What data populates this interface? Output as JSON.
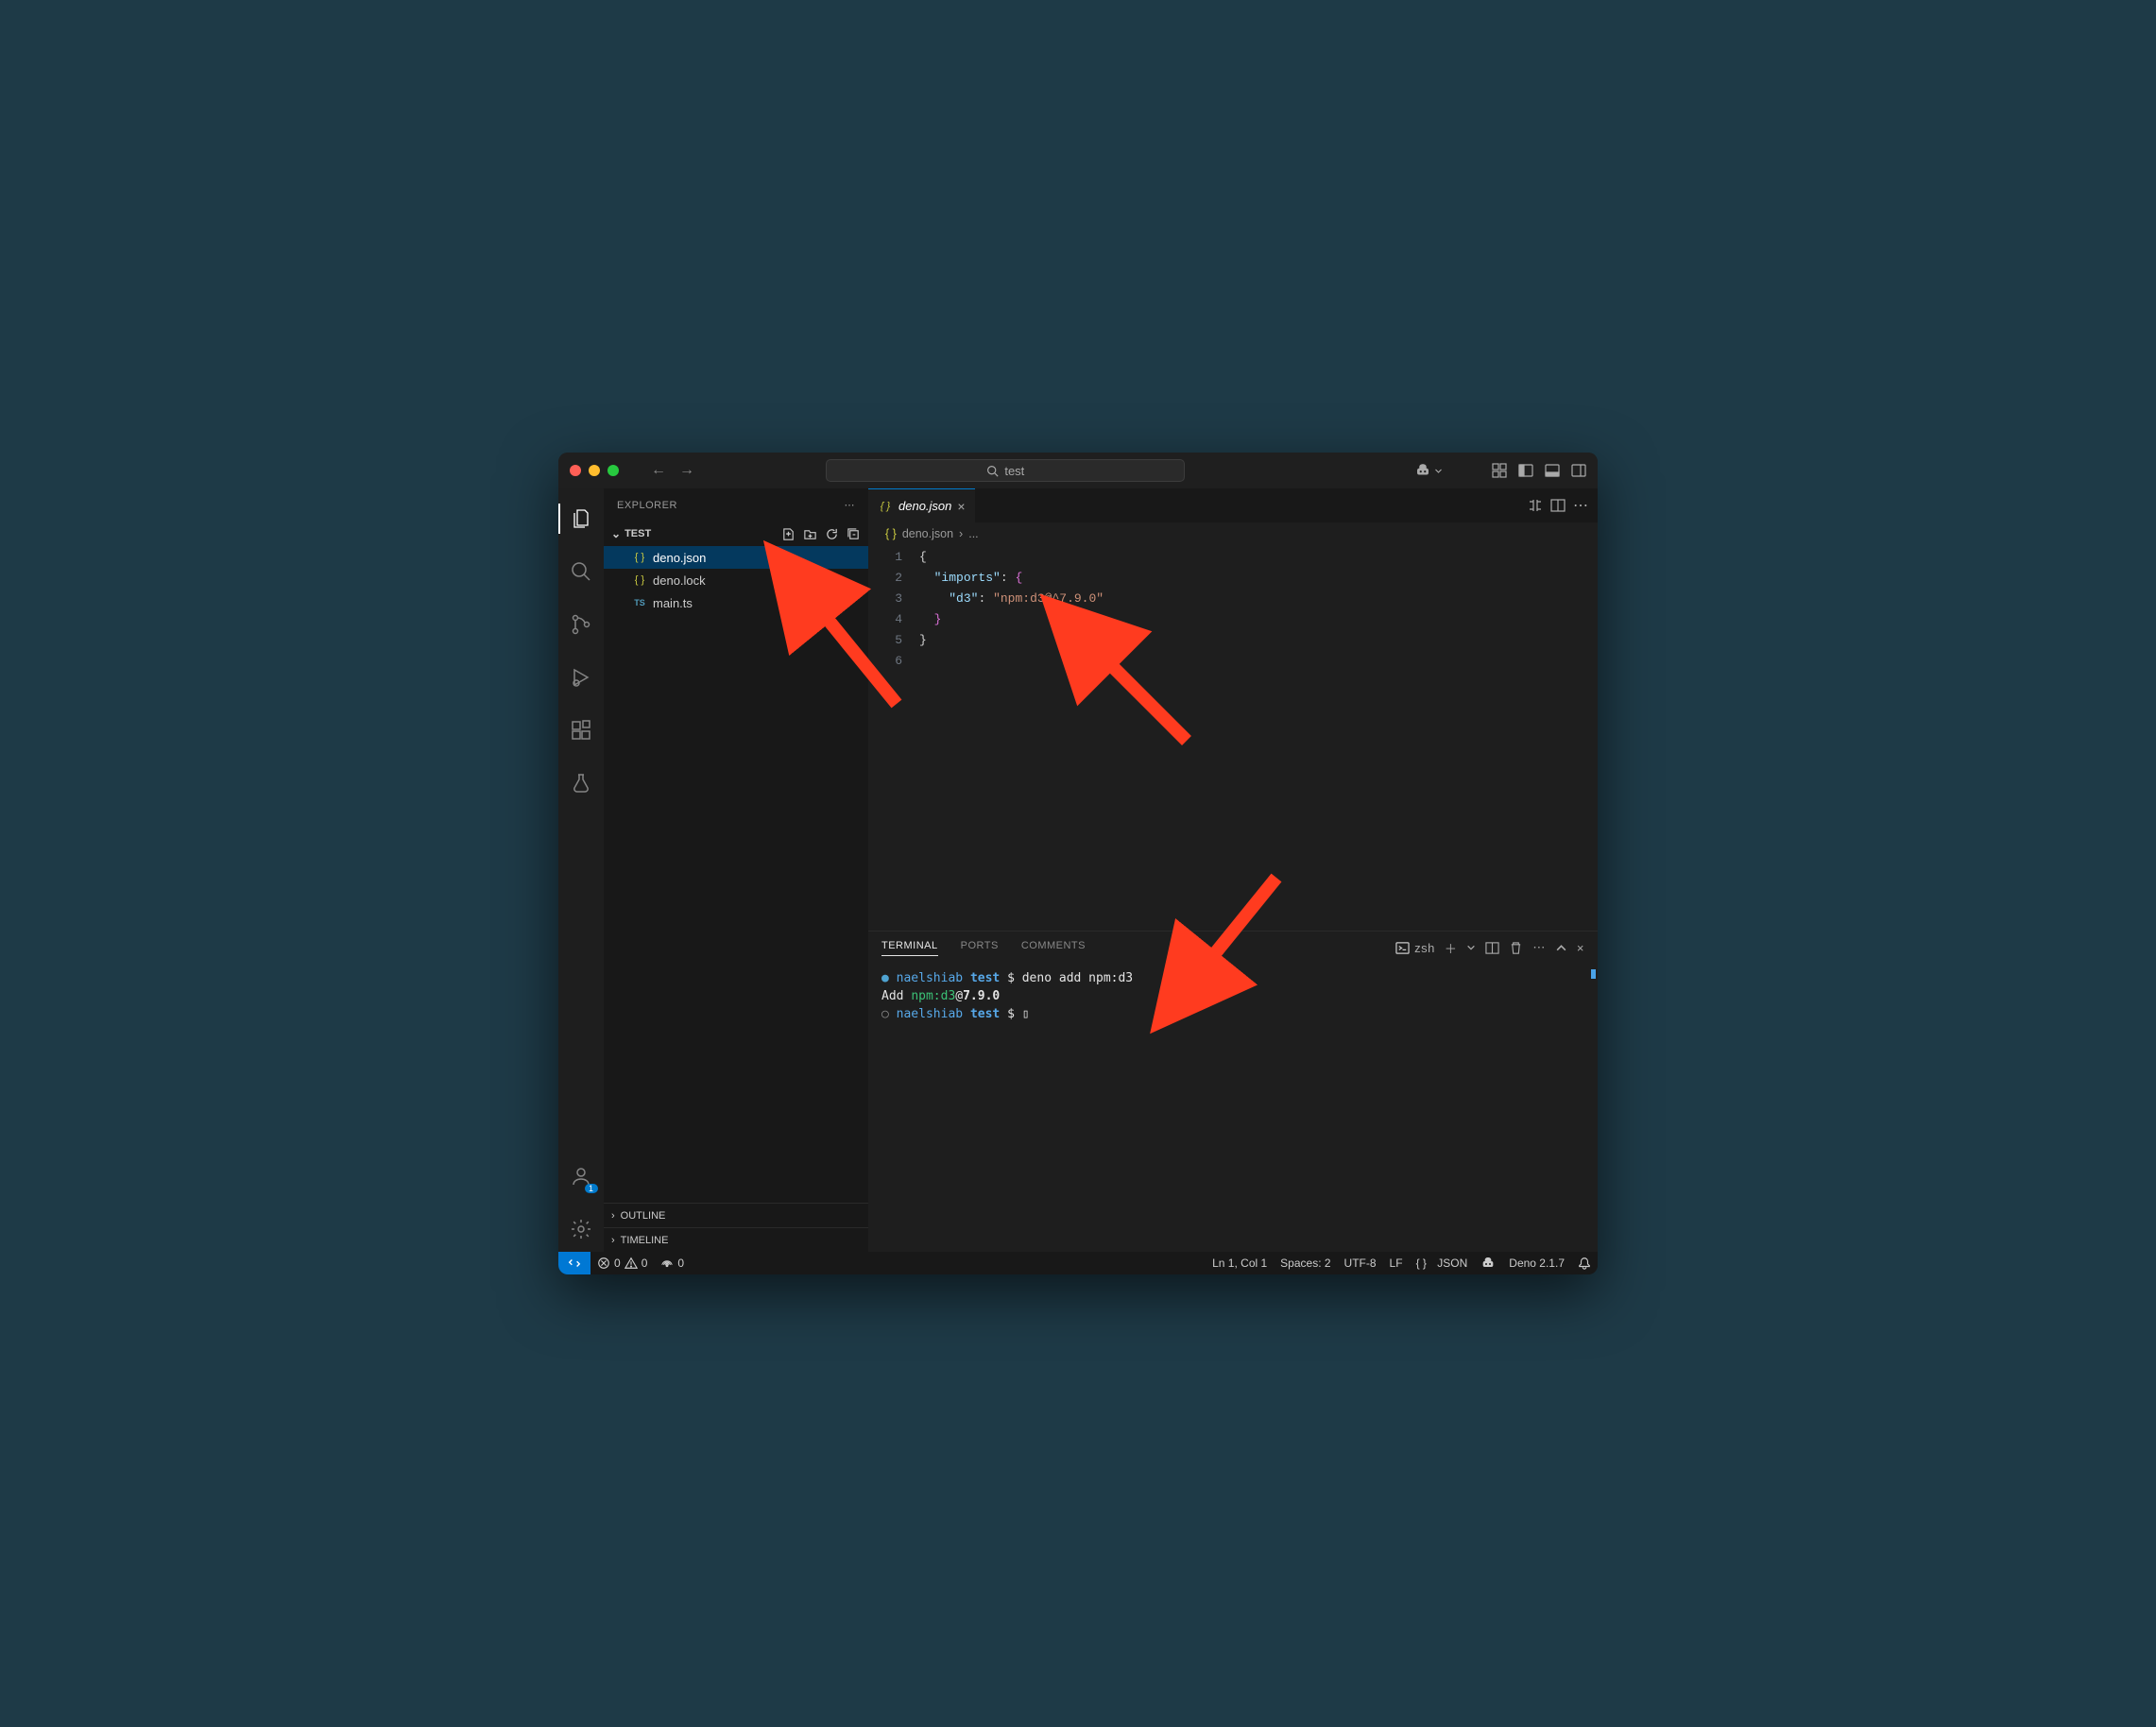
{
  "titlebar": {
    "search_text": "test"
  },
  "sidebar": {
    "title": "EXPLORER",
    "folder": "TEST",
    "files": [
      {
        "name": "deno.json",
        "type": "json",
        "active": true
      },
      {
        "name": "deno.lock",
        "type": "json",
        "active": false
      },
      {
        "name": "main.ts",
        "type": "ts",
        "active": false
      }
    ],
    "sections": {
      "outline": "OUTLINE",
      "timeline": "TIMELINE"
    }
  },
  "tabs": {
    "open": [
      {
        "label": "deno.json",
        "type": "json"
      }
    ]
  },
  "breadcrumb": {
    "file": "deno.json",
    "more": "..."
  },
  "code": {
    "lines": [
      {
        "n": "1",
        "html": "<span class='tok-brace'>{</span>"
      },
      {
        "n": "2",
        "html": "  <span class='tok-key'>\"imports\"</span><span class='tok-op'>:</span> <span class='tok-brace2'>{</span>"
      },
      {
        "n": "3",
        "html": "    <span class='tok-key'>\"d3\"</span><span class='tok-op'>:</span> <span class='tok-str'>\"npm:d3@^7.9.0\"</span>"
      },
      {
        "n": "4",
        "html": "  <span class='tok-brace2'>}</span>"
      },
      {
        "n": "5",
        "html": "<span class='tok-brace'>}</span>"
      },
      {
        "n": "6",
        "html": ""
      }
    ]
  },
  "panel": {
    "tabs": [
      "TERMINAL",
      "PORTS",
      "COMMENTS"
    ],
    "shell_label": "zsh",
    "terminal_lines": [
      {
        "bullet": "●",
        "bclass": "bullet-filled",
        "prefix": "naelshiab",
        "dir": "test",
        "cmd": "deno add npm:d3",
        "prompt": "$"
      },
      {
        "text_pre": "Add ",
        "pkg": "npm:d3",
        "at": "@",
        "ver": "7.9.0"
      },
      {
        "bullet": "○",
        "bclass": "bullet-empty",
        "prefix": "naelshiab",
        "dir": "test",
        "prompt": "$",
        "cursor": "▯"
      }
    ]
  },
  "status": {
    "errors": "0",
    "warnings": "0",
    "ports": "0",
    "cursor": "Ln 1, Col 1",
    "spaces": "Spaces: 2",
    "encoding": "UTF-8",
    "eol": "LF",
    "lang": "JSON",
    "runtime": "Deno 2.1.7"
  }
}
